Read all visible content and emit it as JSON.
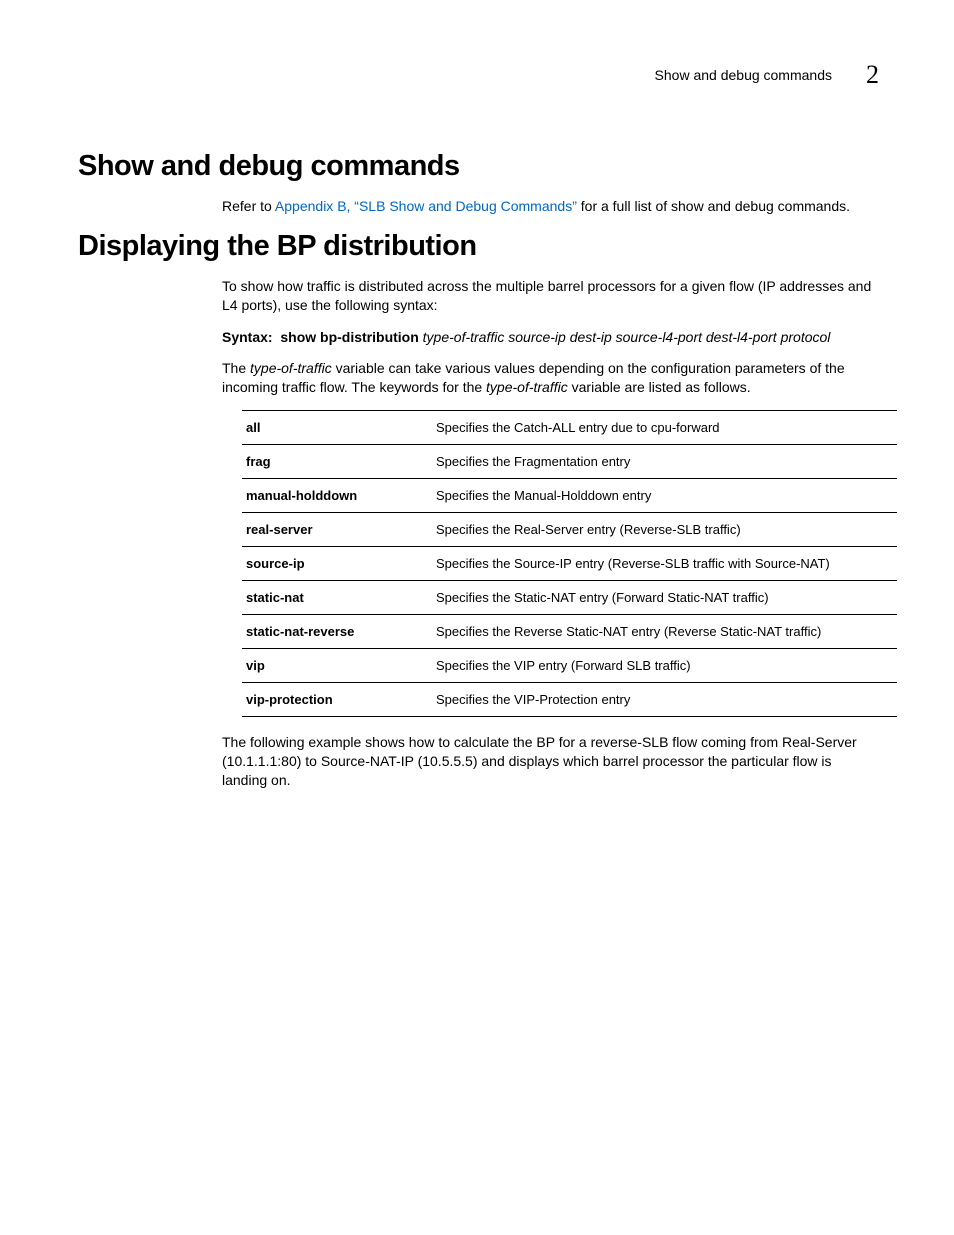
{
  "header": {
    "running_title": "Show and debug commands",
    "chapter_number": "2"
  },
  "section1": {
    "heading": "Show and debug commands",
    "para_prefix": "Refer to ",
    "link_text": "Appendix B, “SLB Show and Debug Commands”",
    "para_suffix": " for a full list of show and debug commands."
  },
  "section2": {
    "heading": "Displaying the BP distribution",
    "intro": "To show how traffic is distributed across the multiple barrel processors for a given flow (IP addresses and L4 ports), use the following syntax:",
    "syntax_label": "Syntax:",
    "syntax_cmd": "show bp-distribution",
    "syntax_args": "type-of-traffic source-ip dest-ip source-l4-port dest-l4-port protocol",
    "desc_pre": "The ",
    "desc_var1": "type-of-traffic",
    "desc_mid": " variable can take various values depending on the configuration parameters of the incoming traffic flow. The keywords for the ",
    "desc_var2": "type-of-traffic",
    "desc_post": " variable are listed as follows.",
    "rows": [
      {
        "key": "all",
        "desc": "Specifies the Catch-ALL entry due to cpu-forward"
      },
      {
        "key": "frag",
        "desc": "Specifies the Fragmentation entry"
      },
      {
        "key": "manual-holddown",
        "desc": "Specifies the Manual-Holddown entry"
      },
      {
        "key": "real-server",
        "desc": "Specifies the Real-Server entry (Reverse-SLB traffic)"
      },
      {
        "key": "source-ip",
        "desc": "Specifies the Source-IP entry (Reverse-SLB traffic with Source-NAT)"
      },
      {
        "key": "static-nat",
        "desc": "Specifies the Static-NAT entry (Forward Static-NAT traffic)"
      },
      {
        "key": "static-nat-reverse",
        "desc": "Specifies the Reverse Static-NAT entry (Reverse Static-NAT traffic)"
      },
      {
        "key": "vip",
        "desc": "Specifies the VIP entry (Forward SLB traffic)"
      },
      {
        "key": "vip-protection",
        "desc": "Specifies the VIP-Protection entry"
      }
    ],
    "example_para": "The following example shows how to calculate the BP for a reverse-SLB flow coming from Real-Server (10.1.1.1:80) to Source-NAT-IP (10.5.5.5) and displays which barrel processor the particular flow is landing on."
  }
}
